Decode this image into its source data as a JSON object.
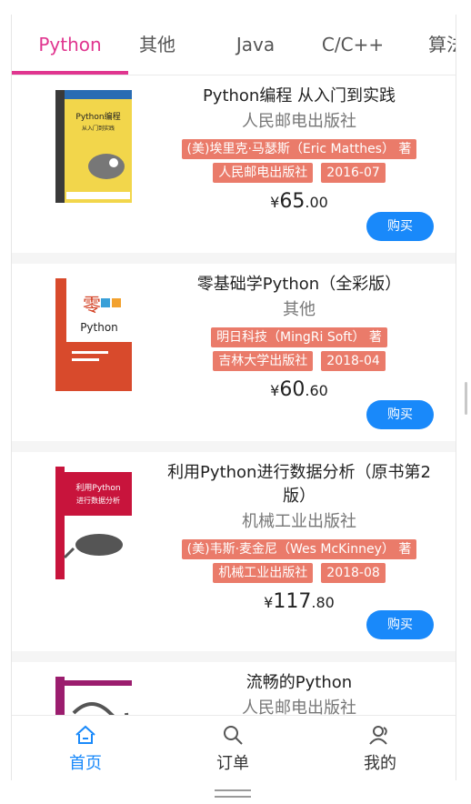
{
  "tabs": [
    "Python",
    "其他",
    "Java",
    "C/C++",
    "算法"
  ],
  "active_tab": "Python",
  "books": [
    {
      "title": "Python编程 从入门到实践",
      "publisher": "人民邮电出版社",
      "author_tag": "(美)埃里克·马瑟斯（Eric Matthes） 著",
      "publisher_tag": "人民邮电出版社",
      "date_tag": "2016-07",
      "price_symbol": "¥",
      "price_int": "65",
      "price_dec": ".00",
      "buy_label": "购买",
      "cover_icon": "book-cover-python-crash-course"
    },
    {
      "title": "零基础学Python（全彩版）",
      "publisher": "其他",
      "author_tag": "明日科技（MingRi Soft） 著",
      "publisher_tag": "吉林大学出版社",
      "date_tag": "2018-04",
      "price_symbol": "¥",
      "price_int": "60",
      "price_dec": ".60",
      "buy_label": "购买",
      "cover_icon": "book-cover-zero-basics-python"
    },
    {
      "title": "利用Python进行数据分析（原书第2版）",
      "publisher": "机械工业出版社",
      "author_tag": "(美)韦斯·麦金尼（Wes McKinney） 著",
      "publisher_tag": "机械工业出版社",
      "date_tag": "2018-08",
      "price_symbol": "¥",
      "price_int": "117",
      "price_dec": ".80",
      "buy_label": "购买",
      "cover_icon": "book-cover-python-data-analysis"
    },
    {
      "title": "流畅的Python",
      "publisher": "人民邮电出版社",
      "cover_icon": "book-cover-fluent-python"
    }
  ],
  "nav": [
    {
      "label": "首页",
      "icon": "home-icon",
      "active": true
    },
    {
      "label": "订单",
      "icon": "search-icon",
      "active": false
    },
    {
      "label": "我的",
      "icon": "user-icon",
      "active": false
    }
  ],
  "colors": {
    "tab_active": "#e0358f",
    "tag_bg": "#ea7b6a",
    "buy_bg": "#1989fa",
    "nav_active": "#1989fa"
  }
}
